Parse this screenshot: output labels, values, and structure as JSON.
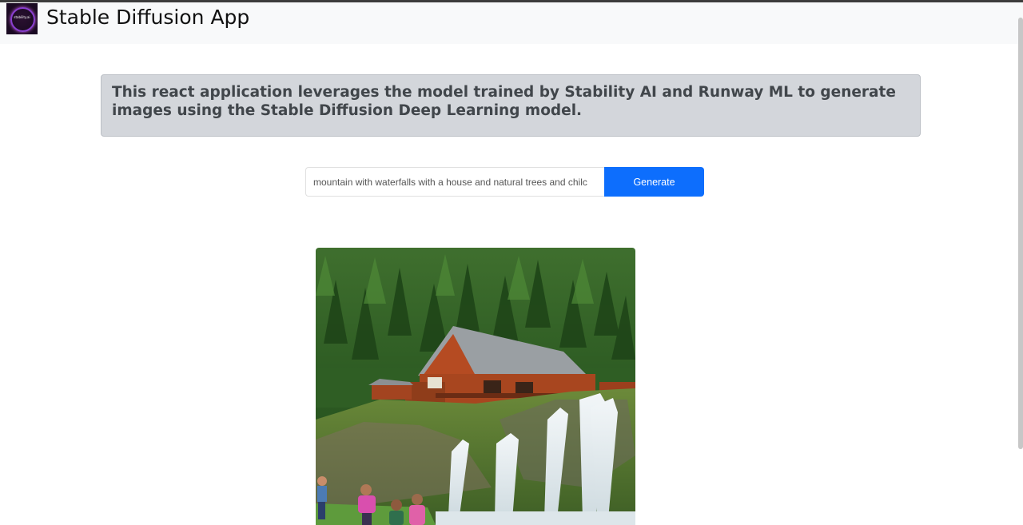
{
  "navbar": {
    "brand": "Stable Diffusion App",
    "logo_text": "stability.ai"
  },
  "intro": {
    "text": "This react application leverages the model trained by Stability AI and Runway ML to generate images using the Stable Diffusion Deep Learning model."
  },
  "prompt": {
    "value": "mountain with waterfalls with a house and natural trees and chilc"
  },
  "generate": {
    "label": "Generate"
  },
  "colors": {
    "accent": "#0d6efd",
    "navbar_bg": "#f8f9fa",
    "alert_bg": "#d3d6db",
    "alert_text": "#41464b"
  },
  "result_image": {
    "description": "generated image"
  }
}
